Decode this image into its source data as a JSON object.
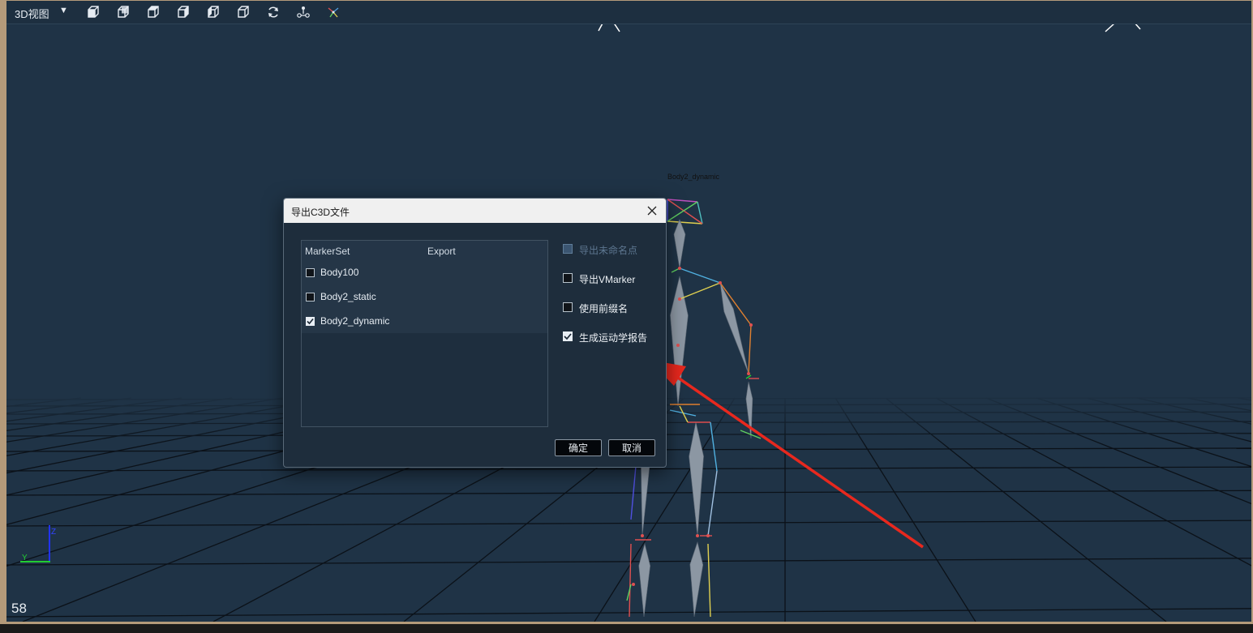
{
  "toolbar": {
    "view_label": "3D视图",
    "dropdown_icon": "caret-down-icon",
    "buttons": [
      {
        "name": "front-view",
        "icon": "cube-front-icon"
      },
      {
        "name": "back-view",
        "icon": "cube-back-icon"
      },
      {
        "name": "left-view",
        "icon": "cube-left-icon"
      },
      {
        "name": "right-view",
        "icon": "cube-right-icon"
      },
      {
        "name": "top-view",
        "icon": "cube-top-icon"
      },
      {
        "name": "bottom-view",
        "icon": "cube-bottom-icon"
      },
      {
        "name": "reset-view",
        "icon": "refresh-icon"
      },
      {
        "name": "tracking-view",
        "icon": "tracking-icon"
      },
      {
        "name": "skeleton-view",
        "icon": "skeleton-icon"
      }
    ]
  },
  "scene": {
    "skeleton_label": "Body2_dynamic",
    "frame_number": "58",
    "axis_labels": {
      "y": "Y",
      "z": "Z"
    }
  },
  "dialog": {
    "title": "导出C3D文件",
    "table": {
      "columns": [
        "MarkerSet",
        "Export"
      ],
      "rows": [
        {
          "label": "Body100",
          "checked": false
        },
        {
          "label": "Body2_static",
          "checked": false
        },
        {
          "label": "Body2_dynamic",
          "checked": true
        }
      ]
    },
    "options": [
      {
        "label": "导出未命名点",
        "checked": false,
        "enabled": false
      },
      {
        "label": "导出VMarker",
        "checked": false,
        "enabled": true
      },
      {
        "label": "使用前缀名",
        "checked": false,
        "enabled": true
      },
      {
        "label": "生成运动学报告",
        "checked": true,
        "enabled": true
      }
    ],
    "ok_label": "确定",
    "cancel_label": "取消"
  },
  "colors": {
    "viewport_bg": "#1f3346",
    "annotation_arrow": "#e8281e",
    "bone": "#8c97a3"
  }
}
